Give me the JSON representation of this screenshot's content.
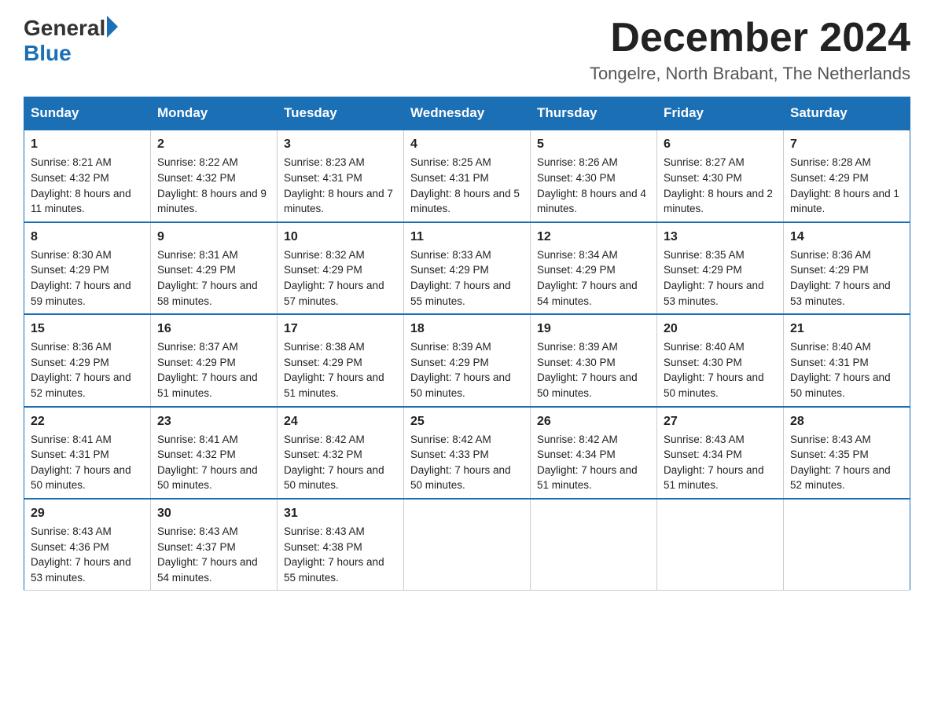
{
  "header": {
    "logo_general": "General",
    "logo_blue": "Blue",
    "month_year": "December 2024",
    "location": "Tongelre, North Brabant, The Netherlands"
  },
  "weekdays": [
    "Sunday",
    "Monday",
    "Tuesday",
    "Wednesday",
    "Thursday",
    "Friday",
    "Saturday"
  ],
  "weeks": [
    [
      {
        "day": "1",
        "sunrise": "8:21 AM",
        "sunset": "4:32 PM",
        "daylight": "8 hours and 11 minutes."
      },
      {
        "day": "2",
        "sunrise": "8:22 AM",
        "sunset": "4:32 PM",
        "daylight": "8 hours and 9 minutes."
      },
      {
        "day": "3",
        "sunrise": "8:23 AM",
        "sunset": "4:31 PM",
        "daylight": "8 hours and 7 minutes."
      },
      {
        "day": "4",
        "sunrise": "8:25 AM",
        "sunset": "4:31 PM",
        "daylight": "8 hours and 5 minutes."
      },
      {
        "day": "5",
        "sunrise": "8:26 AM",
        "sunset": "4:30 PM",
        "daylight": "8 hours and 4 minutes."
      },
      {
        "day": "6",
        "sunrise": "8:27 AM",
        "sunset": "4:30 PM",
        "daylight": "8 hours and 2 minutes."
      },
      {
        "day": "7",
        "sunrise": "8:28 AM",
        "sunset": "4:29 PM",
        "daylight": "8 hours and 1 minute."
      }
    ],
    [
      {
        "day": "8",
        "sunrise": "8:30 AM",
        "sunset": "4:29 PM",
        "daylight": "7 hours and 59 minutes."
      },
      {
        "day": "9",
        "sunrise": "8:31 AM",
        "sunset": "4:29 PM",
        "daylight": "7 hours and 58 minutes."
      },
      {
        "day": "10",
        "sunrise": "8:32 AM",
        "sunset": "4:29 PM",
        "daylight": "7 hours and 57 minutes."
      },
      {
        "day": "11",
        "sunrise": "8:33 AM",
        "sunset": "4:29 PM",
        "daylight": "7 hours and 55 minutes."
      },
      {
        "day": "12",
        "sunrise": "8:34 AM",
        "sunset": "4:29 PM",
        "daylight": "7 hours and 54 minutes."
      },
      {
        "day": "13",
        "sunrise": "8:35 AM",
        "sunset": "4:29 PM",
        "daylight": "7 hours and 53 minutes."
      },
      {
        "day": "14",
        "sunrise": "8:36 AM",
        "sunset": "4:29 PM",
        "daylight": "7 hours and 53 minutes."
      }
    ],
    [
      {
        "day": "15",
        "sunrise": "8:36 AM",
        "sunset": "4:29 PM",
        "daylight": "7 hours and 52 minutes."
      },
      {
        "day": "16",
        "sunrise": "8:37 AM",
        "sunset": "4:29 PM",
        "daylight": "7 hours and 51 minutes."
      },
      {
        "day": "17",
        "sunrise": "8:38 AM",
        "sunset": "4:29 PM",
        "daylight": "7 hours and 51 minutes."
      },
      {
        "day": "18",
        "sunrise": "8:39 AM",
        "sunset": "4:29 PM",
        "daylight": "7 hours and 50 minutes."
      },
      {
        "day": "19",
        "sunrise": "8:39 AM",
        "sunset": "4:30 PM",
        "daylight": "7 hours and 50 minutes."
      },
      {
        "day": "20",
        "sunrise": "8:40 AM",
        "sunset": "4:30 PM",
        "daylight": "7 hours and 50 minutes."
      },
      {
        "day": "21",
        "sunrise": "8:40 AM",
        "sunset": "4:31 PM",
        "daylight": "7 hours and 50 minutes."
      }
    ],
    [
      {
        "day": "22",
        "sunrise": "8:41 AM",
        "sunset": "4:31 PM",
        "daylight": "7 hours and 50 minutes."
      },
      {
        "day": "23",
        "sunrise": "8:41 AM",
        "sunset": "4:32 PM",
        "daylight": "7 hours and 50 minutes."
      },
      {
        "day": "24",
        "sunrise": "8:42 AM",
        "sunset": "4:32 PM",
        "daylight": "7 hours and 50 minutes."
      },
      {
        "day": "25",
        "sunrise": "8:42 AM",
        "sunset": "4:33 PM",
        "daylight": "7 hours and 50 minutes."
      },
      {
        "day": "26",
        "sunrise": "8:42 AM",
        "sunset": "4:34 PM",
        "daylight": "7 hours and 51 minutes."
      },
      {
        "day": "27",
        "sunrise": "8:43 AM",
        "sunset": "4:34 PM",
        "daylight": "7 hours and 51 minutes."
      },
      {
        "day": "28",
        "sunrise": "8:43 AM",
        "sunset": "4:35 PM",
        "daylight": "7 hours and 52 minutes."
      }
    ],
    [
      {
        "day": "29",
        "sunrise": "8:43 AM",
        "sunset": "4:36 PM",
        "daylight": "7 hours and 53 minutes."
      },
      {
        "day": "30",
        "sunrise": "8:43 AM",
        "sunset": "4:37 PM",
        "daylight": "7 hours and 54 minutes."
      },
      {
        "day": "31",
        "sunrise": "8:43 AM",
        "sunset": "4:38 PM",
        "daylight": "7 hours and 55 minutes."
      },
      null,
      null,
      null,
      null
    ]
  ]
}
